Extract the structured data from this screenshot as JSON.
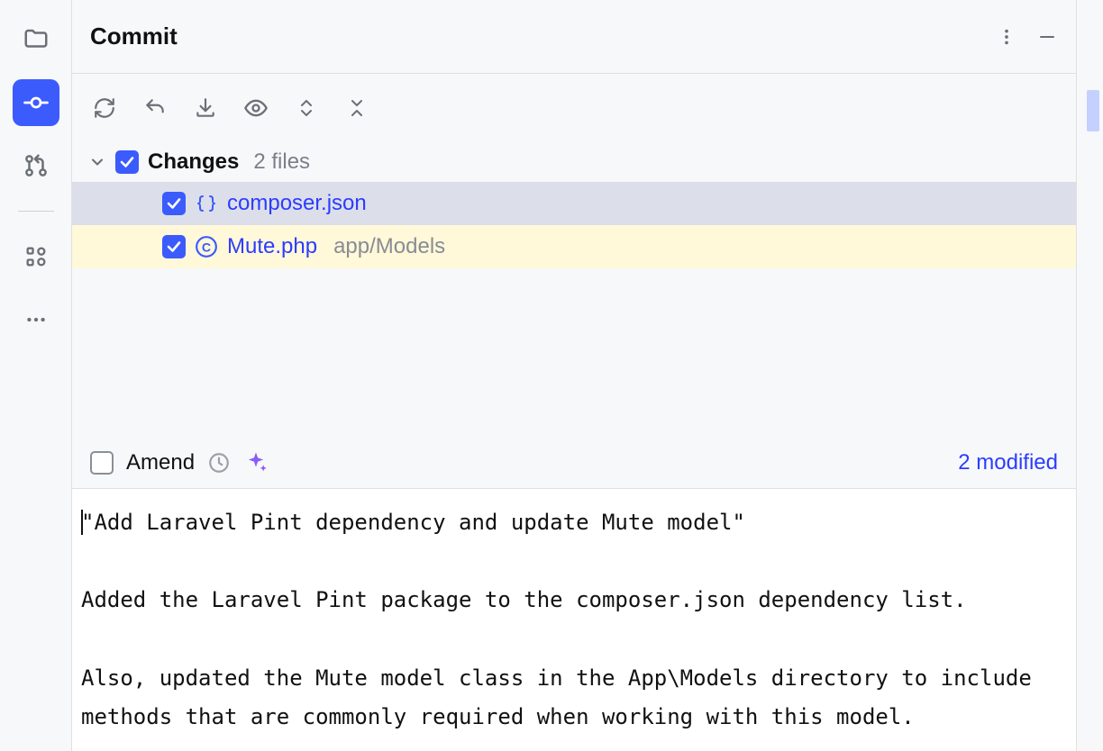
{
  "header": {
    "title": "Commit"
  },
  "changes": {
    "label": "Changes",
    "count_label": "2 files",
    "files": [
      {
        "name": "composer.json",
        "path": "",
        "icon": "json"
      },
      {
        "name": "Mute.php",
        "path": "app/Models",
        "icon": "class"
      }
    ]
  },
  "amend": {
    "label": "Amend",
    "modified_label": "2 modified"
  },
  "commit_message": "\"Add Laravel Pint dependency and update Mute model\"\n\nAdded the Laravel Pint package to the composer.json dependency list.\n\nAlso, updated the Mute model class in the App\\Models directory to include methods that are commonly required when working with this model."
}
